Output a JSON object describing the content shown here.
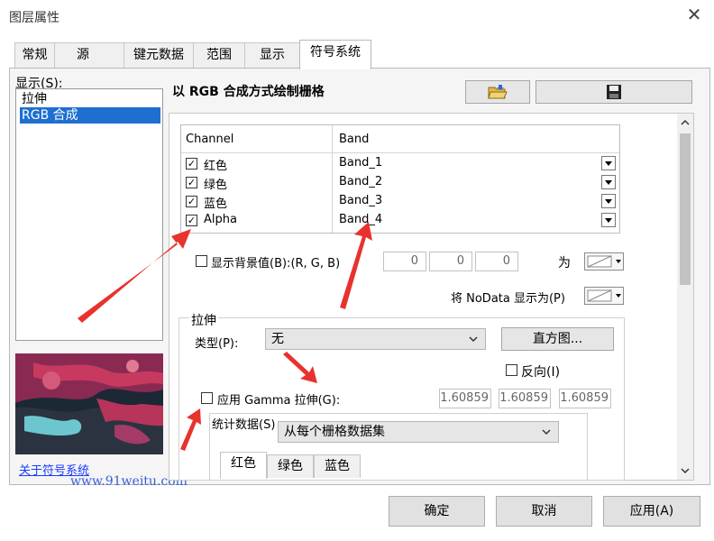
{
  "window": {
    "title": "图层属性",
    "close_glyph": "✕"
  },
  "tabs": [
    "常规",
    "源",
    "键元数据",
    "范围",
    "显示",
    "符号系统"
  ],
  "sidebar": {
    "label": "显示(S):",
    "items": [
      "拉伸",
      "RGB 合成"
    ],
    "link": "关于符号系统"
  },
  "watermark": "www.91weitu.com",
  "main": {
    "title": "以 RGB 合成方式绘制栅格",
    "grid": {
      "headers": [
        "Channel",
        "Band"
      ],
      "rows": [
        {
          "channel": "红色",
          "band": "Band_1",
          "checked": true
        },
        {
          "channel": "绿色",
          "band": "Band_2",
          "checked": true
        },
        {
          "channel": "蓝色",
          "band": "Band_3",
          "checked": true
        },
        {
          "channel": "Alpha",
          "band": "Band_4",
          "checked": true
        }
      ]
    },
    "background": {
      "label": "显示背景值(B):(R, G, B)",
      "values": [
        "0",
        "0",
        "0"
      ],
      "as_label": "为"
    },
    "nodata_label": "将 NoData 显示为(P)",
    "stretch": {
      "group_label": "拉伸",
      "type_label": "类型(P):",
      "type_value": "无",
      "histogram_button": "直方图...",
      "invert_label": "反向(I)",
      "gamma_label": "应用 Gamma 拉伸(G):",
      "gamma_values": [
        "1.60859",
        "1.60859",
        "1.60859"
      ],
      "stats_label": "统计数据(S)",
      "stats_value": "从每个栅格数据集",
      "color_tabs": [
        "红色",
        "绿色",
        "蓝色"
      ]
    }
  },
  "buttons": {
    "ok": "确定",
    "cancel": "取消",
    "apply": "应用(A)"
  },
  "colors": {
    "selection": "#1e6fd0",
    "arrow": "#e8322d",
    "link": "#1a3cff"
  }
}
